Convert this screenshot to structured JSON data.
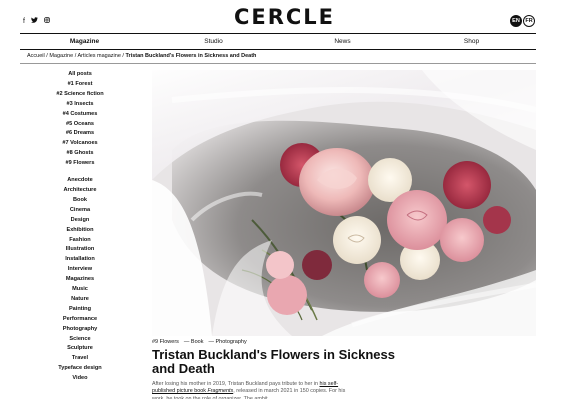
{
  "header": {
    "logo": "CERCLE",
    "social": [
      {
        "icon": "facebook-icon",
        "glyph": "f"
      },
      {
        "icon": "twitter-icon",
        "glyph": "🐦"
      },
      {
        "icon": "instagram-icon",
        "glyph": "◎"
      }
    ],
    "languages": {
      "active": "EN",
      "inactive": "FR"
    }
  },
  "nav": {
    "items": [
      "Magazine",
      "Studio",
      "News",
      "Shop"
    ]
  },
  "breadcrumb": {
    "home": "Accueil",
    "section": "Magazine",
    "articles": "Articles magazine",
    "current": "Tristan Buckland's Flowers in Sickness and Death",
    "sep": " / "
  },
  "sidebar": {
    "issues": [
      "All posts",
      "#1 Forest",
      "#2 Science fiction",
      "#3 Insects",
      "#4 Costumes",
      "#5 Oceans",
      "#6 Dreams",
      "#7 Volcanoes",
      "#8 Ghosts",
      "#9 Flowers"
    ],
    "categories": [
      "Anecdote",
      "Architecture",
      "Book",
      "Cinema",
      "Design",
      "Exhibition",
      "Fashion",
      "Illustration",
      "Installation",
      "Interview",
      "Magazines",
      "Music",
      "Nature",
      "Painting",
      "Performance",
      "Photography",
      "Science",
      "Sculpture",
      "Travel",
      "Typeface design",
      "Video"
    ]
  },
  "article": {
    "tags": [
      "#9 Flowers",
      "— Book",
      "— Photography"
    ],
    "title": "Tristan Buckland's Flowers in Sickness and Death",
    "excerpt_start": "After losing his mother in 2019, Tristan Buckland pays tribute to her in ",
    "excerpt_link": "his self-published picture book ",
    "excerpt_book": "Fragments",
    "excerpt_end": ", released in march 2021 in 150 copies. For his work, he took on the role of organizer. The ambit..."
  },
  "colors": {
    "text": "#111111",
    "rule": "#111111",
    "muted": "#555555"
  }
}
